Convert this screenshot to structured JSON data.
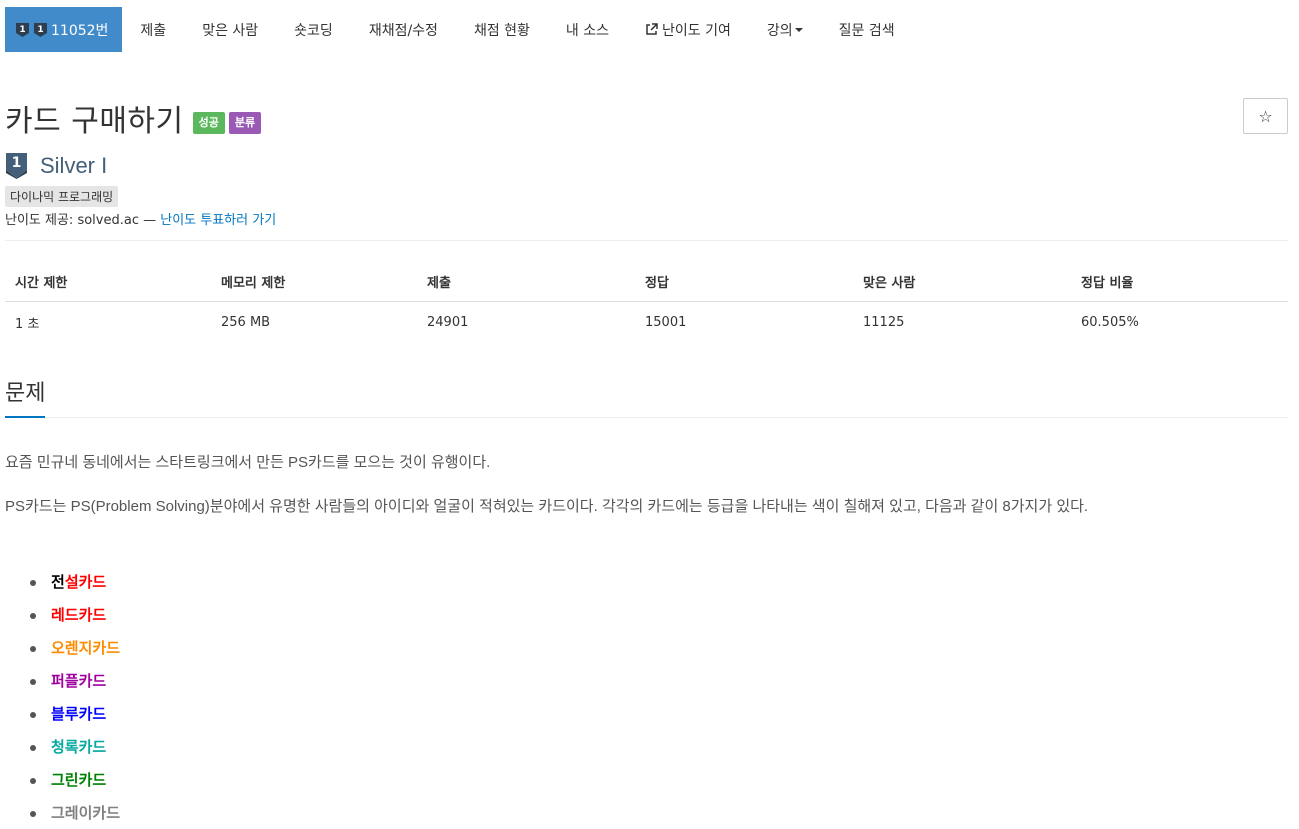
{
  "nav": {
    "problem_number": "11052번",
    "items": [
      "제출",
      "맞은 사람",
      "숏코딩",
      "재채점/수정",
      "채점 현황",
      "내 소스",
      "난이도 기여",
      "강의",
      "질문 검색"
    ]
  },
  "problem": {
    "title": "카드 구매하기",
    "labels": [
      "성공",
      "분류"
    ],
    "tier": "Silver I",
    "tier_number": "1",
    "tag": "다이나믹 프로그래밍",
    "provider_prefix": "난이도 제공: solved.ac — ",
    "provider_link": "난이도 투표하러 가기",
    "star": "☆"
  },
  "info_table": {
    "headers": [
      "시간 제한",
      "메모리 제한",
      "제출",
      "정답",
      "맞은 사람",
      "정답 비율"
    ],
    "row": [
      "1 초",
      "256 MB",
      "24901",
      "15001",
      "11125",
      "60.505%"
    ]
  },
  "section_title": "문제",
  "paragraphs": [
    "요즘 민규네 동네에서는 스타트링크에서 만든 PS카드를 모으는 것이 유행이다.",
    "PS카드는 PS(Problem Solving)분야에서 유명한 사람들의 아이디와 얼굴이 적혀있는 카드이다. 각각의 카드에는 등급을 나타내는 색이 칠해져 있고, 다음과 같이 8가지가 있다."
  ],
  "cards": [
    {
      "first": "전",
      "rest": "설카드",
      "first_color": "#000000",
      "color": "#ff0000"
    },
    {
      "first": "",
      "rest": "레드카드",
      "first_color": "#ff0000",
      "color": "#ff0000"
    },
    {
      "first": "",
      "rest": "오렌지카드",
      "first_color": "#ff8c00",
      "color": "#ff8c00"
    },
    {
      "first": "",
      "rest": "퍼플카드",
      "first_color": "#a000a0",
      "color": "#a000a0"
    },
    {
      "first": "",
      "rest": "블루카드",
      "first_color": "#0000ff",
      "color": "#0000ff"
    },
    {
      "first": "",
      "rest": "청록카드",
      "first_color": "#03a89e",
      "color": "#03a89e"
    },
    {
      "first": "",
      "rest": "그린카드",
      "first_color": "#008000",
      "color": "#008000"
    },
    {
      "first": "",
      "rest": "그레이카드",
      "first_color": "#808080",
      "color": "#808080"
    }
  ],
  "colors": {
    "nav_active_bg": "#428bca",
    "label_success": "#5cb85c",
    "label_purple": "#9b59b6",
    "link": "#0076c0",
    "tier": "#435f7a"
  }
}
